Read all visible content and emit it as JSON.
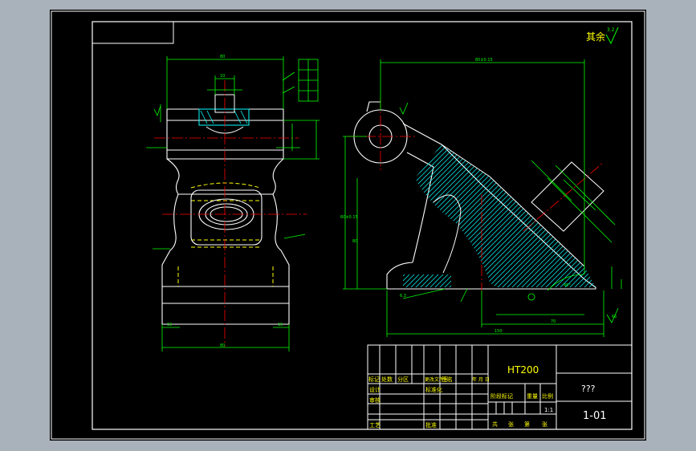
{
  "app": {
    "view": "CAD drawing viewport"
  },
  "colors": {
    "background": "#a9b2bb",
    "sheet": "#000000",
    "frame": "#ffffff",
    "outline": "#ffffff",
    "dimension": "#00ff00",
    "centerline": "#ff0000",
    "hatch": "#00ffff",
    "hidden": "#ffff00",
    "title_text": "#ffff00"
  },
  "roughness": {
    "label": "其余",
    "value": "3.2"
  },
  "material": "HT200",
  "drawing_name": "???",
  "drawing_number": "1-01",
  "scale": "1:1",
  "title_block": {
    "row_labels": [
      "标记",
      "处数",
      "分区",
      "更改文件号",
      "签名",
      "年 月 日"
    ],
    "side_labels": [
      "设计",
      "审核",
      "工艺"
    ],
    "standardize": "标准化",
    "approve": "批准",
    "stage_labels": [
      "阶段标记",
      "重量",
      "比例"
    ],
    "sheet_labels": [
      "共",
      "张",
      "第",
      "张"
    ]
  }
}
